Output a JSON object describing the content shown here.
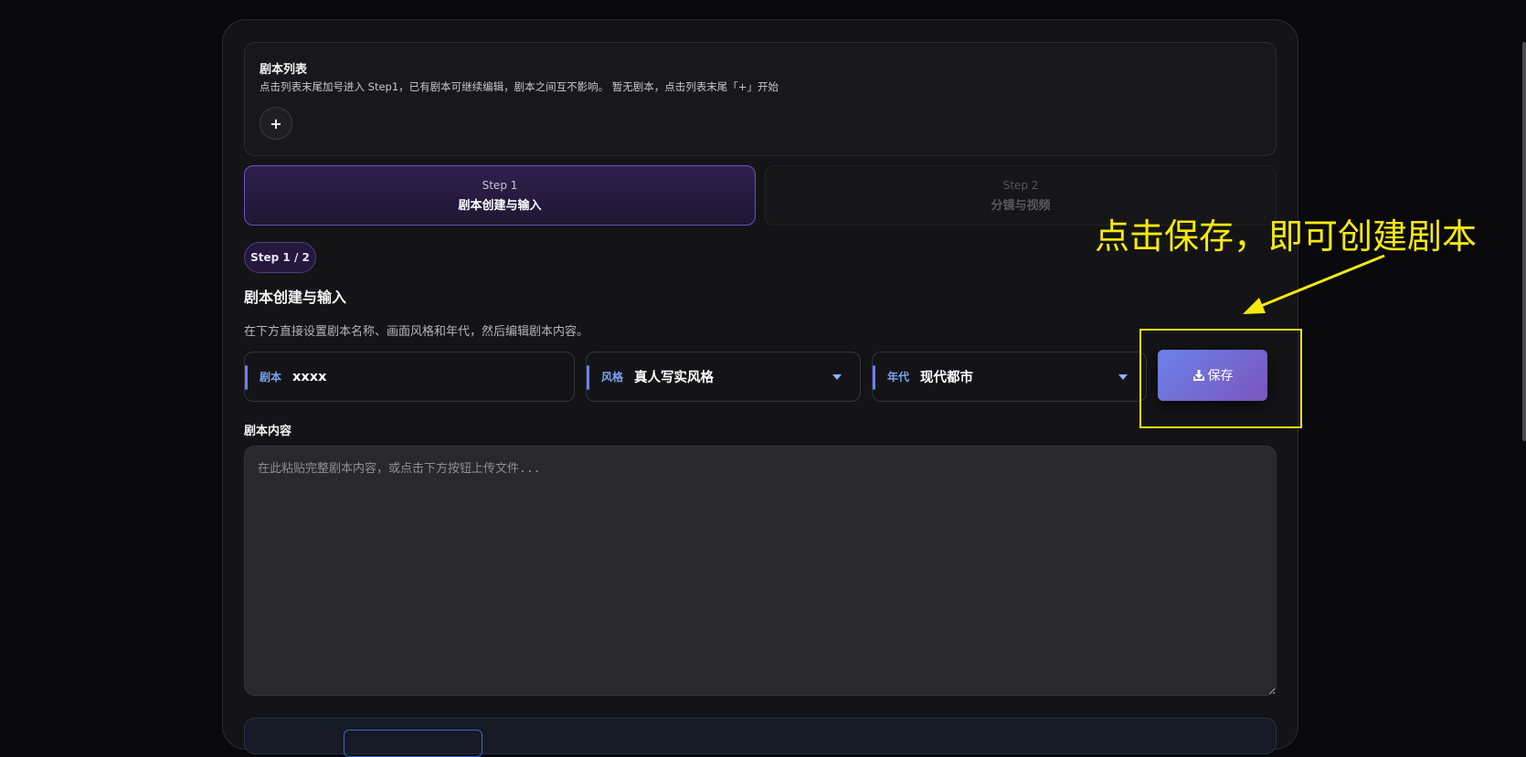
{
  "script_list": {
    "title": "剧本列表",
    "description": "点击列表末尾加号进入 Step1，已有剧本可继续编辑，剧本之间互不影响。  暂无剧本，点击列表末尾「+」开始",
    "add_label": "+"
  },
  "steps": [
    {
      "num": "Step 1",
      "name": "剧本创建与输入",
      "active": true
    },
    {
      "num": "Step 2",
      "name": "分镜与视频",
      "active": false
    }
  ],
  "step_badge": "Step 1 / 2",
  "section": {
    "title": "剧本创建与输入",
    "description": "在下方直接设置剧本名称、画面风格和年代，然后编辑剧本内容。"
  },
  "fields": {
    "script": {
      "label": "剧本",
      "value": "xxxx"
    },
    "style": {
      "label": "风格",
      "value": "真人写实风格"
    },
    "era": {
      "label": "年代",
      "value": "现代都市"
    }
  },
  "save_button": {
    "label": "保存",
    "icon": "download-icon"
  },
  "annotation": {
    "text": "点击保存，即可创建剧本",
    "color": "#f5e90e"
  },
  "content": {
    "label": "剧本内容",
    "placeholder": "在此粘贴完整剧本内容，或点击下方按钮上传文件...",
    "value": ""
  },
  "colors": {
    "accent": "#6c7ff0",
    "active_step_border": "#6d4fc6",
    "save_gradient_start": "#6b82e8",
    "save_gradient_end": "#7a55bd",
    "highlight": "#f1e80c"
  }
}
